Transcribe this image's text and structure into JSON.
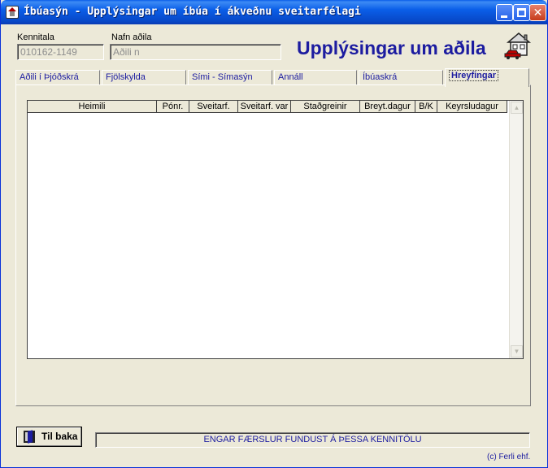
{
  "window": {
    "title": "Íbúasýn - Upplýsingar um íbúa í ákveðnu sveitarfélagi",
    "min_glyph": "",
    "max_glyph": "",
    "close_glyph": "✕"
  },
  "header": {
    "kennitala_label": "Kennitala",
    "kennitala_value": "010162-1149",
    "nafn_label": "Nafn aðila",
    "nafn_value": "Aðili n",
    "title": "Upplýsingar um aðila"
  },
  "tabs": [
    {
      "label": "Aðili í Þjóðskrá"
    },
    {
      "label": "Fjölskylda"
    },
    {
      "label": "Sími - Símasýn"
    },
    {
      "label": "Annáll"
    },
    {
      "label": "Íbúaskrá"
    },
    {
      "label": "Hreyfingar"
    }
  ],
  "grid": {
    "columns": [
      "Heimili",
      "Pónr.",
      "Sveitarf.",
      "Sveitarf. var",
      "Staðgreinir",
      "Breyt.dagur",
      "B/K",
      "Keyrsludagur"
    ],
    "up_glyph": "▲",
    "down_glyph": "▼"
  },
  "footer": {
    "back_label": "Til baka",
    "status": "ENGAR FÆRSLUR FUNDUST Á ÞESSA KENNITÖLU",
    "copyright": "(c) Ferli ehf."
  }
}
